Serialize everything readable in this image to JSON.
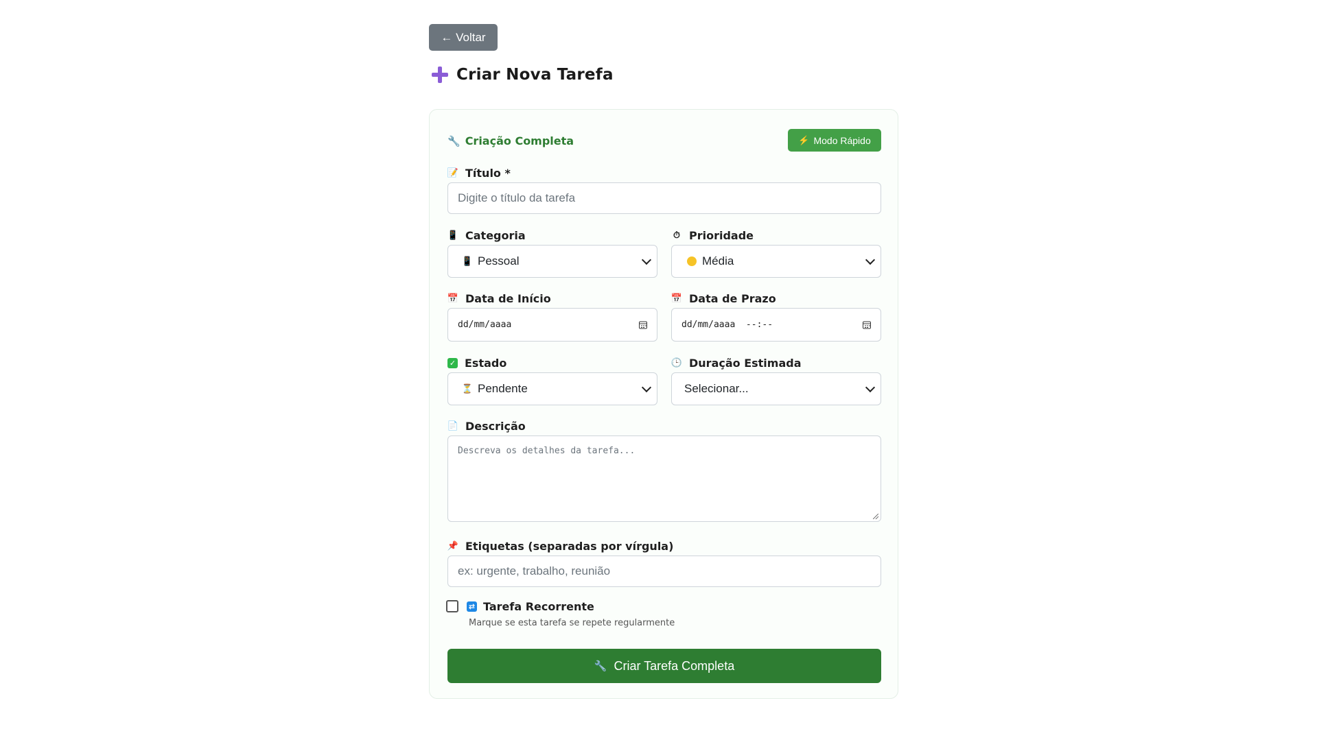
{
  "back_button": {
    "label": "← Voltar"
  },
  "page": {
    "title": "Criar Nova Tarefa"
  },
  "mode": {
    "label": "Criação Completa",
    "switch_button": "Modo Rápido"
  },
  "fields": {
    "title": {
      "label": "Título *",
      "placeholder": "Digite o título da tarefa",
      "icon": "memo-icon"
    },
    "category": {
      "label": "Categoria",
      "value": "Pessoal",
      "icon": "mobile-phone-icon"
    },
    "priority": {
      "label": "Prioridade",
      "value": "Média",
      "icon": "stopwatch-icon",
      "value_color": "#f6c327"
    },
    "start_date": {
      "label": "Data de Início",
      "placeholder": "dd/mm/aaaa",
      "icon": "calendar-icon"
    },
    "due_date": {
      "label": "Data de Prazo",
      "placeholder": "dd/mm/aaaa  --:--",
      "icon": "calendar-icon"
    },
    "status": {
      "label": "Estado",
      "value": "Pendente",
      "icon": "check-box-icon"
    },
    "duration": {
      "label": "Duração Estimada",
      "value": "Selecionar...",
      "icon": "clock-icon"
    },
    "description": {
      "label": "Descrição",
      "placeholder": "Descreva os detalhes da tarefa...",
      "icon": "page-icon"
    },
    "tags": {
      "label": "Etiquetas (separadas por vírgula)",
      "placeholder": "ex: urgente, trabalho, reunião",
      "icon": "pushpin-icon"
    }
  },
  "recurring": {
    "label": "Tarefa Recorrente",
    "hint": "Marque se esta tarefa se repete regularmente",
    "checked": false
  },
  "submit": {
    "label": "Criar Tarefa Completa"
  },
  "colors": {
    "primary_green": "#2e7d32",
    "quick_green": "#43a047",
    "back_gray": "#6c757d",
    "plus_purple": "#8a5cd6"
  }
}
